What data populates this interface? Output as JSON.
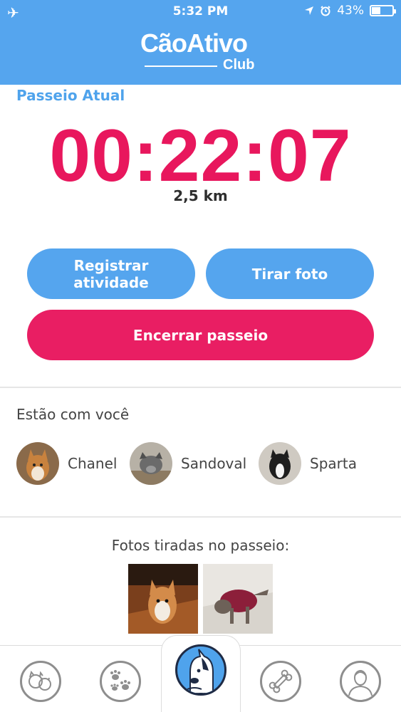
{
  "status_bar": {
    "time": "5:32 PM",
    "battery": "43%",
    "battery_level": 0.43,
    "icons": [
      "airplane-icon",
      "location-arrow-icon",
      "alarm-icon",
      "battery-icon"
    ]
  },
  "header": {
    "logo_main": "CãoAtivo",
    "logo_sub": "Club"
  },
  "walk": {
    "title": "Passeio Atual",
    "timer": "00:22:07",
    "distance": "2,5 km"
  },
  "actions": {
    "register_line1": "Registrar",
    "register_line2": "atividade",
    "photo": "Tirar foto",
    "end": "Encerrar passeio"
  },
  "companions": {
    "title": "Estão com você",
    "dogs": [
      {
        "name": "Chanel"
      },
      {
        "name": "Sandoval"
      },
      {
        "name": "Sparta"
      }
    ]
  },
  "photos": {
    "title": "Fotos tiradas no passeio:"
  },
  "tabbar": {
    "tabs": [
      "dogs-icon",
      "paws-icon",
      "bull-terrier-logo-icon",
      "bone-icon",
      "profile-icon"
    ]
  },
  "colors": {
    "brand_blue": "#55a5ee",
    "accent_pink": "#e91e63",
    "timer_pink": "#e8175d"
  }
}
